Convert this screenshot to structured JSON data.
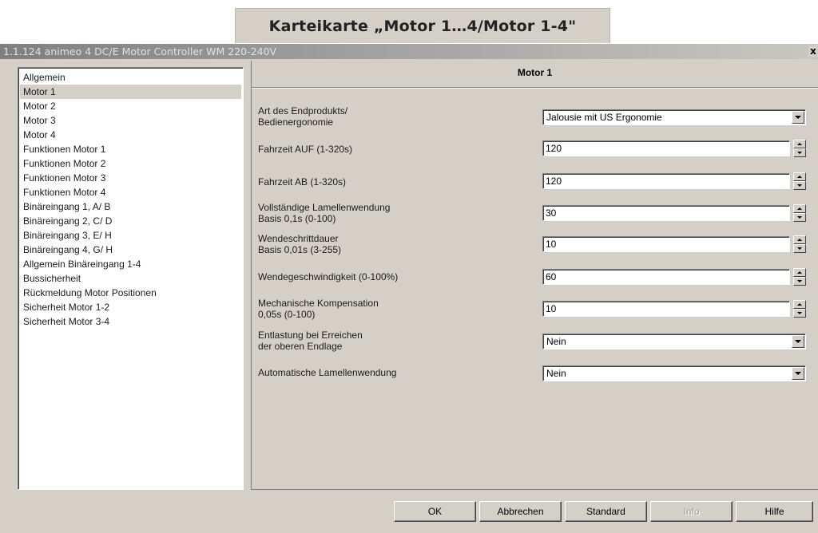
{
  "caption": "Karteikarte „Motor 1…4/Motor 1-4\"",
  "window": {
    "title": "1.1.124 animeo 4 DC/E Motor Controller WM 220-240V",
    "close": "x"
  },
  "sidebar": {
    "items": [
      {
        "label": "Allgemein",
        "selected": false
      },
      {
        "label": "Motor 1",
        "selected": true
      },
      {
        "label": "Motor 2",
        "selected": false
      },
      {
        "label": "Motor 3",
        "selected": false
      },
      {
        "label": "Motor 4",
        "selected": false
      },
      {
        "label": "Funktionen Motor 1",
        "selected": false
      },
      {
        "label": "Funktionen Motor 2",
        "selected": false
      },
      {
        "label": "Funktionen Motor 3",
        "selected": false
      },
      {
        "label": "Funktionen Motor 4",
        "selected": false
      },
      {
        "label": "Binäreingang 1, A/ B",
        "selected": false
      },
      {
        "label": "Binäreingang 2, C/ D",
        "selected": false
      },
      {
        "label": "Binäreingang 3, E/ H",
        "selected": false
      },
      {
        "label": "Binäreingang 4, G/ H",
        "selected": false
      },
      {
        "label": "Allgemein Binäreingang 1-4",
        "selected": false
      },
      {
        "label": "Bussicherheit",
        "selected": false
      },
      {
        "label": "Rückmeldung Motor Positionen",
        "selected": false
      },
      {
        "label": "Sicherheit Motor 1-2",
        "selected": false
      },
      {
        "label": "Sicherheit Motor 3-4",
        "selected": false
      }
    ]
  },
  "main": {
    "title": "Motor 1",
    "params": [
      {
        "label1": "Art des Endprodukts/",
        "label2": "Bedienergonomie",
        "type": "select",
        "value": "Jalousie mit US Ergonomie"
      },
      {
        "label1": "Fahrzeit AUF (1-320s)",
        "label2": "",
        "type": "spinner",
        "value": "120"
      },
      {
        "label1": "Fahrzeit AB (1-320s)",
        "label2": "",
        "type": "spinner",
        "value": "120"
      },
      {
        "label1": "Vollständige Lamellenwendung",
        "label2": "Basis 0,1s (0-100)",
        "type": "spinner",
        "value": "30"
      },
      {
        "label1": "Wendeschrittdauer",
        "label2": "Basis 0,01s (3-255)",
        "type": "spinner",
        "value": "10"
      },
      {
        "label1": "Wendegeschwindigkeit (0-100%)",
        "label2": "",
        "type": "spinner",
        "value": "60"
      },
      {
        "label1": "Mechanische Kompensation",
        "label2": "0,05s (0-100)",
        "type": "spinner",
        "value": "10"
      },
      {
        "label1": "Entlastung bei Erreichen",
        "label2": "der oberen Endlage",
        "type": "select",
        "value": "Nein"
      },
      {
        "label1": "Automatische Lamellenwendung",
        "label2": "",
        "type": "select",
        "value": "Nein"
      }
    ]
  },
  "buttons": {
    "ok": "OK",
    "cancel": "Abbrechen",
    "standard": "Standard",
    "info": "Info",
    "help": "Hilfe"
  },
  "colors": {
    "dialog_bg": "#d4d0c8",
    "titlebar_start": "#7f7f7f",
    "titlebar_end": "#c9c7c2"
  }
}
